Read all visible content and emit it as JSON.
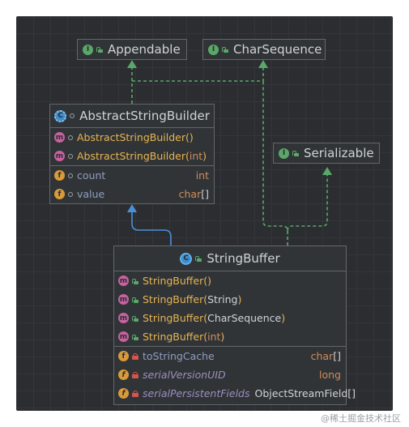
{
  "interfaces": {
    "appendable": {
      "name": "Appendable",
      "icon": "interface-icon"
    },
    "charsequence": {
      "name": "CharSequence",
      "icon": "interface-icon"
    },
    "serializable": {
      "name": "Serializable",
      "icon": "interface-icon"
    }
  },
  "abstract_builder": {
    "name": "AbstractStringBuilder",
    "methods": [
      {
        "name": "AbstractStringBuilder()",
        "param": ""
      },
      {
        "name": "AbstractStringBuilder(",
        "param": "int",
        "close": ")"
      }
    ],
    "fields": [
      {
        "name": "count",
        "type": "int"
      },
      {
        "name": "value",
        "type_main": "char",
        "type_suffix": "[]"
      }
    ]
  },
  "string_buffer": {
    "name": "StringBuffer",
    "methods": [
      {
        "text": "StringBuffer()"
      },
      {
        "text": "StringBuffer(",
        "param": "String",
        "close": ")"
      },
      {
        "text": "StringBuffer(",
        "param": "CharSequence",
        "close": ")"
      },
      {
        "text": "StringBuffer(",
        "param": "int",
        "close": ")"
      }
    ],
    "fields": [
      {
        "name": "toStringCache",
        "type_main": "char",
        "type_suffix": "[]"
      },
      {
        "name": "serialVersionUID",
        "type": "long"
      },
      {
        "name": "serialPersistentFields",
        "type": "ObjectStreamField[]"
      }
    ]
  },
  "watermark": "@稀土掘金技术社区",
  "colors": {
    "background": "#2b2d30",
    "box_border": "#62666b",
    "method_name": "#e6b450",
    "keyword": "#d28b5a",
    "field_name": "#8f9dbf",
    "implements_arrow": "#59a869",
    "extends_arrow": "#4a90d9"
  }
}
